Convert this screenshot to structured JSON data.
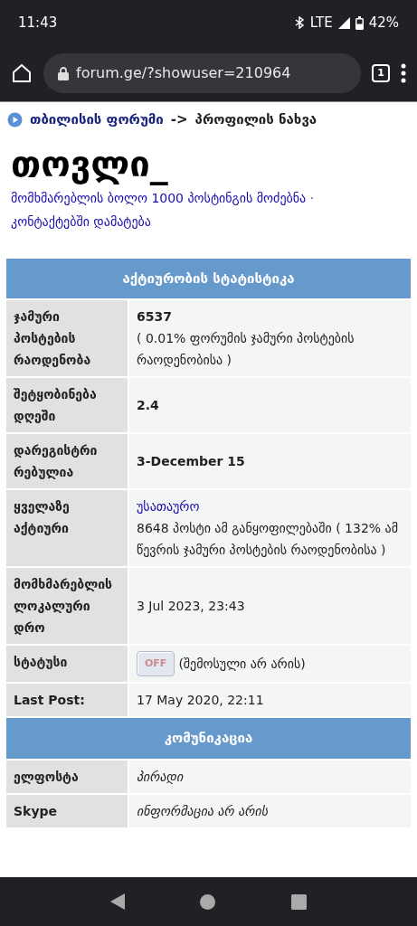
{
  "status_bar": {
    "time": "11:43",
    "network": "LTE",
    "battery": "42%"
  },
  "browser": {
    "url": "forum.ge/?showuser=210964",
    "tab_count": "1"
  },
  "breadcrumb": {
    "link": "თბილისის ფორუმი",
    "separator": "->",
    "current": "პროფილის ნახვა"
  },
  "title": "თოვლი_",
  "links": [
    {
      "text": "მომხმარებლის ბოლო 1000 პოსტინგის მოძებნა"
    },
    {
      "text": "კონტაქტებში დამატება"
    }
  ],
  "link_separator": "·",
  "sections": [
    {
      "title": "აქტიურობის სტატისტიკა",
      "rows": [
        {
          "kind": "bold",
          "label": "ჯამური პოსტების რაოდენობა",
          "value": "6537",
          "note": "( 0.01% ფორუმის ჯამური პოსტების რაოდენობისა )"
        },
        {
          "kind": "bold",
          "label": "შეტყობინება დღეში",
          "value": "2.4"
        },
        {
          "kind": "bold",
          "label": "დარეგისტრი რებულია",
          "value": "3-December 15"
        },
        {
          "kind": "link",
          "label": "ყველაზე აქტიური",
          "value": "უსათაურო",
          "note": "8648 პოსტი ამ განყოფილებაში ( 132% ამ წევრის ჯამური პოსტების რაოდენობისა )"
        },
        {
          "kind": "plain",
          "label": "მომხმარებლის ლოკალური დრო",
          "value": "3 Jul 2023, 23:43"
        },
        {
          "kind": "status",
          "label": "სტატუსი",
          "badge": "OFF",
          "online": false,
          "value": "(შემოსული არ არის)"
        },
        {
          "kind": "plain",
          "label": "Last Post:",
          "value": "17 May 2020, 22:11"
        }
      ]
    },
    {
      "title": "კომუნიკაცია",
      "rows": [
        {
          "kind": "italic",
          "label": "ელფოსტა",
          "value": "პირადი"
        },
        {
          "kind": "italic",
          "label": "Skype",
          "value": "ინფორმაცია არ არის"
        }
      ]
    }
  ]
}
